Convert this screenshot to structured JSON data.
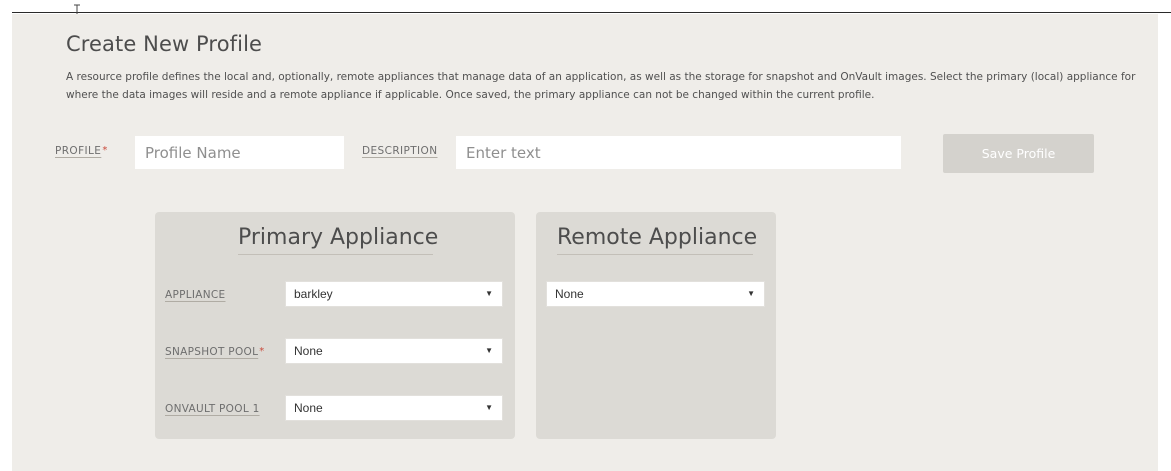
{
  "form": {
    "title": "Create New Profile",
    "description": "A resource profile defines the local and, optionally, remote appliances that manage data of an application, as well as the storage for snapshot and OnVault images. Select the primary (local) appliance for where the data images will reside and a remote appliance if applicable. Once saved, the primary appliance can not be changed within the current profile.",
    "profile_label": "PROFILE",
    "profile_placeholder": "Profile Name",
    "profile_value": "",
    "description_label": "DESCRIPTION",
    "description_placeholder": "Enter text",
    "description_value": "",
    "required_marker": "*",
    "save_label": "Save Profile"
  },
  "primary": {
    "title": "Primary Appliance",
    "appliance_label": "APPLIANCE",
    "appliance_value": "barkley",
    "snapshot_label": "SNAPSHOT POOL",
    "snapshot_value": "None",
    "onvault_label": "ONVAULT POOL 1",
    "onvault_value": "None"
  },
  "remote": {
    "title": "Remote Appliance",
    "appliance_value": "None"
  },
  "icons": {
    "dropdown": "triangle-down",
    "cursor": "text-cursor"
  },
  "colors": {
    "panel_bg": "#efede9",
    "card_bg": "#dcdad5",
    "required": "#c94a3c",
    "save_button_disabled": "#d4d2cd"
  }
}
